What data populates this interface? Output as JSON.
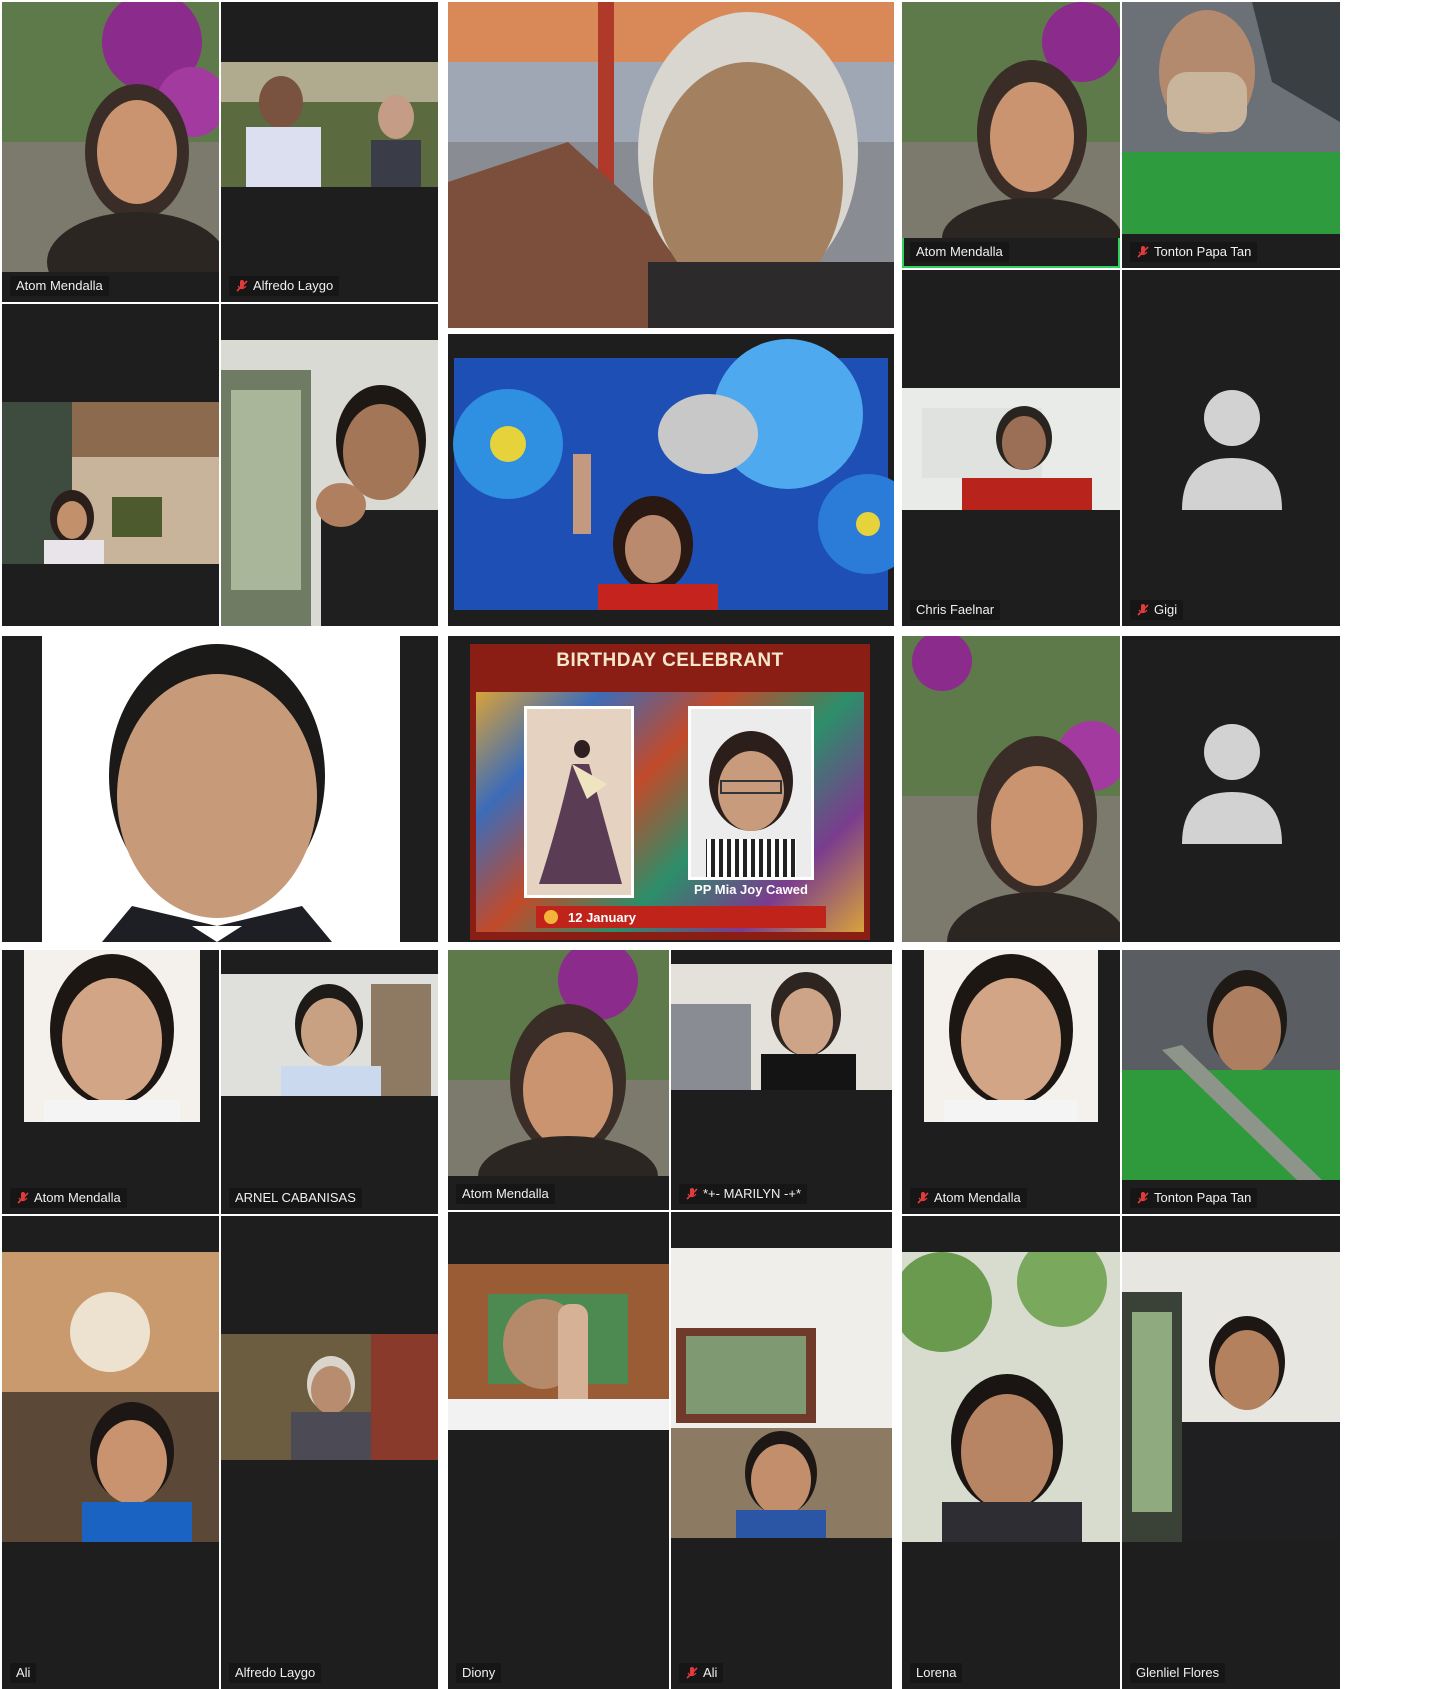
{
  "colors": {
    "tile_bg": "#1e1e1e",
    "label_bg": "#141414",
    "label_text": "#f0f0f0",
    "muted": "#e23b3b",
    "active_speaker": "#2fd35b"
  },
  "mute_icon": "mic-muted-icon",
  "avatar_icon": "person-placeholder-icon",
  "screen1": {
    "tiles": [
      {
        "name": "Atom Mendalla",
        "muted": false
      },
      {
        "name": "Alfredo Laygo",
        "muted": true
      },
      {
        "name": "",
        "muted": false
      },
      {
        "name": "",
        "muted": false
      }
    ]
  },
  "screen3": {
    "tiles": [
      {
        "name": "Atom Mendalla",
        "muted": false
      },
      {
        "name": "Tonton Papa Tan",
        "muted": true
      },
      {
        "name": "Chris Faelnar",
        "muted": false
      },
      {
        "name": "Gigi",
        "muted": true
      }
    ]
  },
  "birthday": {
    "title": "BIRTHDAY CELEBRANT",
    "celebrant": "PP Mia Joy Cawed",
    "date": "12 January"
  },
  "screen7": {
    "tiles": [
      {
        "name": "Atom Mendalla",
        "muted": true
      },
      {
        "name": "ARNEL CABANISAS",
        "muted": false
      },
      {
        "name": "Ali",
        "muted": false
      },
      {
        "name": "Alfredo Laygo",
        "muted": false
      }
    ]
  },
  "screen8": {
    "tiles": [
      {
        "name": "Atom Mendalla",
        "muted": false
      },
      {
        "name": "*+- MARILYN -+*",
        "muted": true
      },
      {
        "name": "Diony",
        "muted": false
      },
      {
        "name": "Ali",
        "muted": true
      }
    ]
  },
  "screen9": {
    "tiles": [
      {
        "name": "Atom Mendalla",
        "muted": true
      },
      {
        "name": "Tonton Papa Tan",
        "muted": true
      },
      {
        "name": "Lorena",
        "muted": false
      },
      {
        "name": "Glenliel Flores",
        "muted": false
      }
    ]
  }
}
